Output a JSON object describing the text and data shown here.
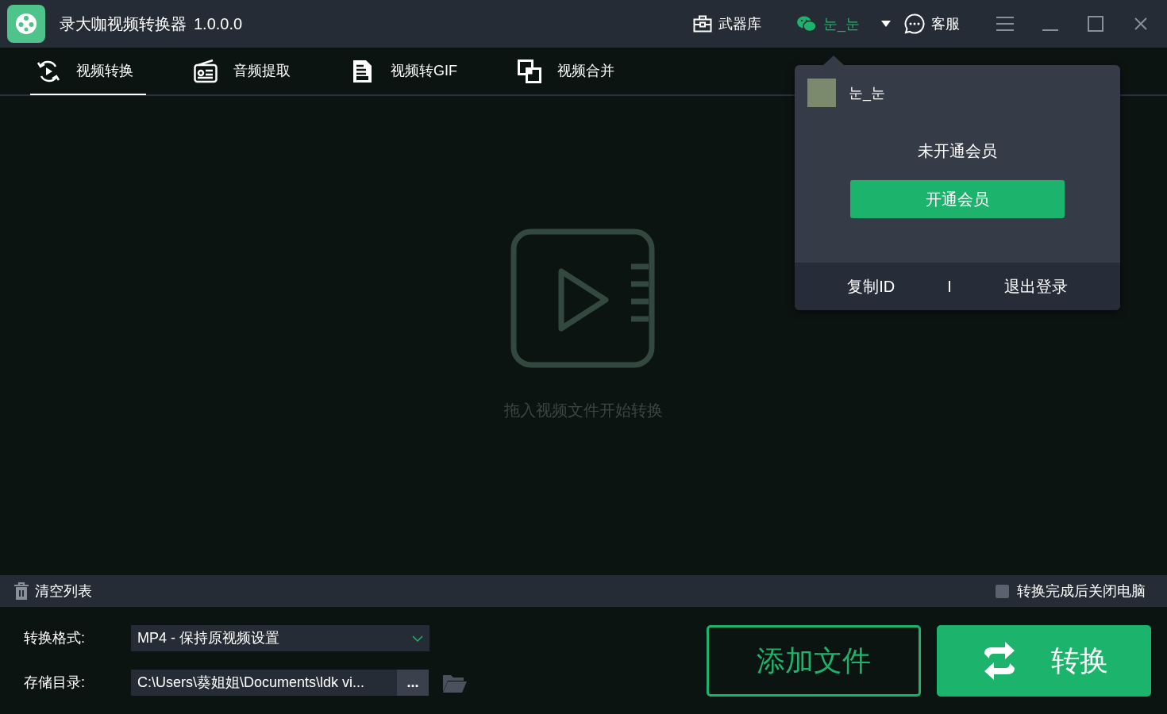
{
  "app": {
    "title": "录大咖视频转换器",
    "version": "1.0.0.0"
  },
  "header": {
    "toolbox": "武器库",
    "user_name": "눈_눈",
    "support": "客服"
  },
  "tabs": [
    {
      "label": "视频转换",
      "selected": true
    },
    {
      "label": "音频提取",
      "selected": false
    },
    {
      "label": "视频转GIF",
      "selected": false
    },
    {
      "label": "视频合并",
      "selected": false
    }
  ],
  "drop_hint": "拖入视频文件开始转换",
  "user_menu": {
    "user_name": "눈_눈",
    "membership_status": "未开通会员",
    "upgrade_button": "开通会员",
    "copy_id": "复制ID",
    "separator": "I",
    "logout": "退出登录"
  },
  "list_bar": {
    "clear_list": "清空列表",
    "shutdown_option": {
      "label": "转换完成后关闭电脑",
      "checked": false
    }
  },
  "settings": {
    "format_label": "转换格式:",
    "format_value": "MP4 - 保持原视频设置",
    "folder_label": "存储目录:",
    "folder_value": "C:\\Users\\葵姐姐\\Documents\\ldk vi...",
    "browse_button": "..."
  },
  "actions": {
    "add_files": "添加文件",
    "convert": "转换"
  }
}
